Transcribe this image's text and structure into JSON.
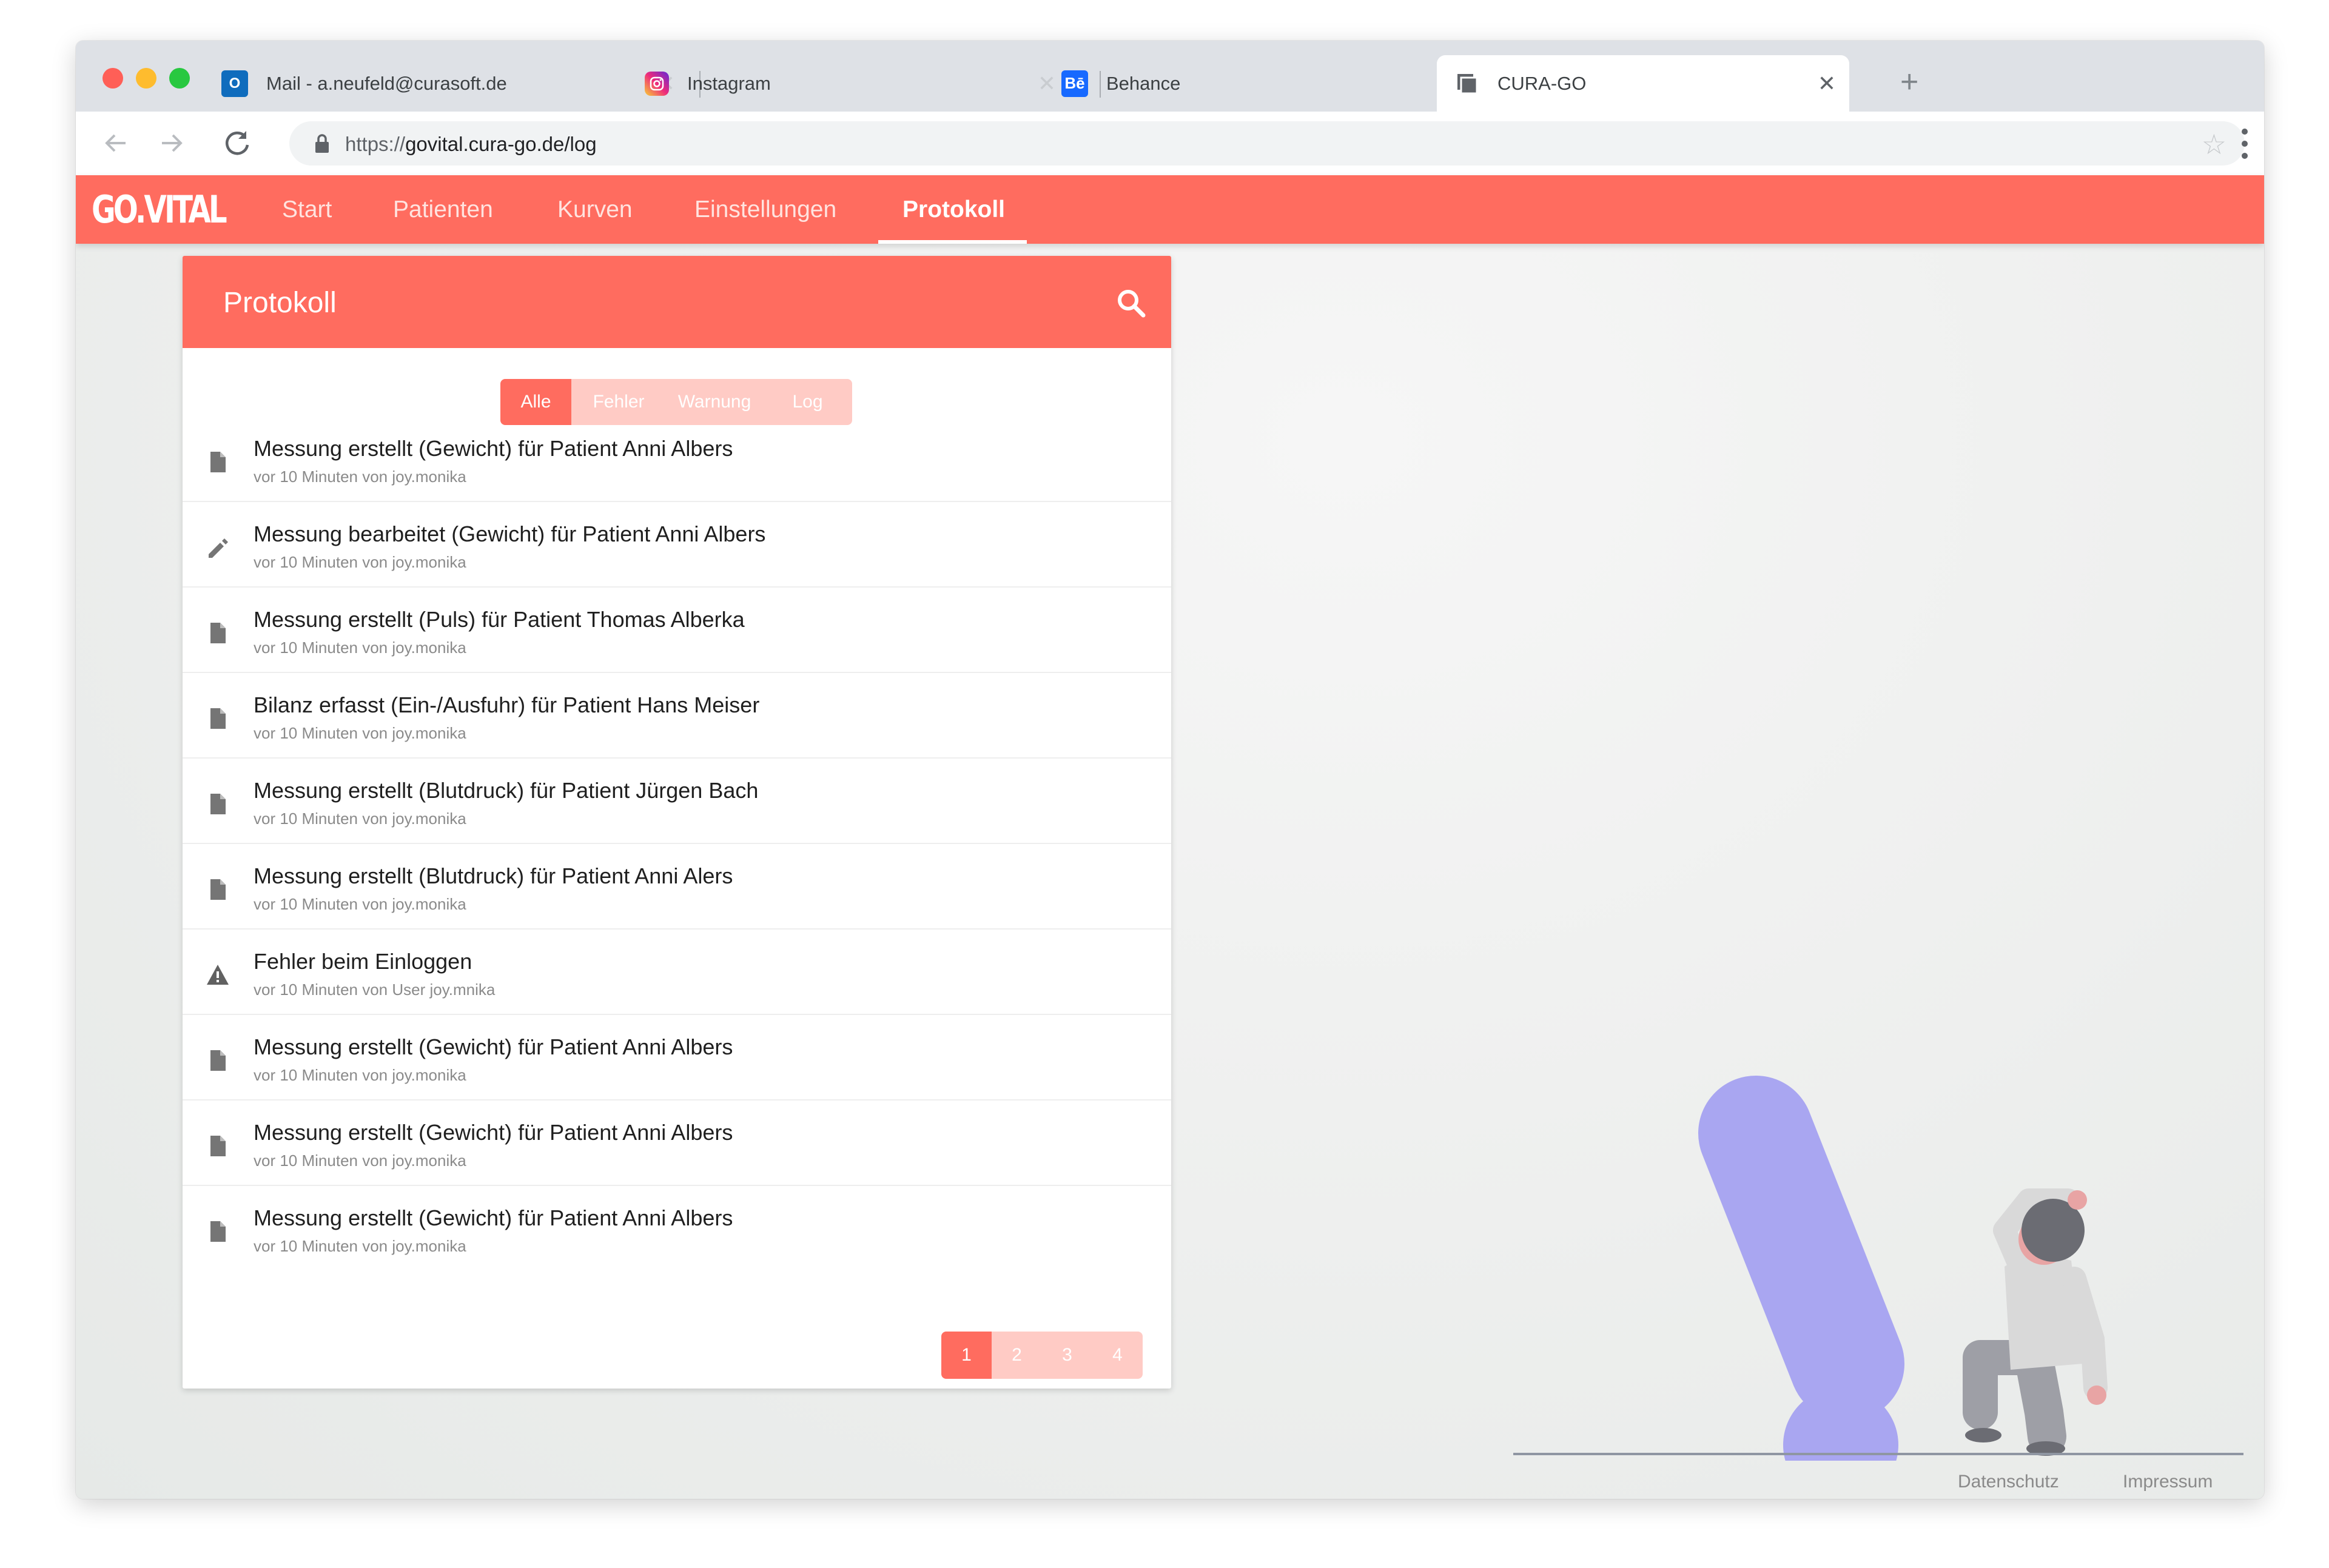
{
  "browser": {
    "tabs": [
      {
        "title": "Mail - a.neufeld@curasoft.de",
        "icon": "outlook-icon",
        "active": false
      },
      {
        "title": "Instagram",
        "icon": "instagram-icon",
        "active": false
      },
      {
        "title": "Behance",
        "icon": "behance-icon",
        "active": false
      },
      {
        "title": "CURA-GO",
        "icon": "window-icon",
        "active": true
      }
    ],
    "url": {
      "scheme": "https://",
      "host": "govital.cura-go.de/log"
    }
  },
  "app": {
    "logo": "GO.VITAL",
    "nav": [
      "Start",
      "Patienten",
      "Kurven",
      "Einstellungen",
      "Protokoll"
    ],
    "active_nav": "Protokoll",
    "accent_color": "#ff6c5f"
  },
  "card": {
    "title": "Protokoll",
    "filters": [
      "Alle",
      "Fehler",
      "Warnung",
      "Log"
    ],
    "active_filter": "Alle",
    "entries": [
      {
        "icon": "document-icon",
        "title": "Messung erstellt (Gewicht) für Patient Anni Albers",
        "sub": "vor 10 Minuten von joy.monika"
      },
      {
        "icon": "pencil-icon",
        "title": "Messung bearbeitet (Gewicht) für Patient Anni Albers",
        "sub": "vor 10 Minuten von joy.monika"
      },
      {
        "icon": "document-icon",
        "title": "Messung erstellt (Puls) für Patient Thomas Alberka",
        "sub": "vor 10 Minuten von joy.monika"
      },
      {
        "icon": "document-icon",
        "title": "Bilanz erfasst (Ein-/Ausfuhr) für Patient Hans Meiser",
        "sub": "vor 10 Minuten von joy.monika"
      },
      {
        "icon": "document-icon",
        "title": "Messung erstellt (Blutdruck) für Patient Jürgen Bach",
        "sub": "vor 10 Minuten von joy.monika"
      },
      {
        "icon": "document-icon",
        "title": "Messung erstellt (Blutdruck) für Patient Anni Alers",
        "sub": "vor 10 Minuten von joy.monika"
      },
      {
        "icon": "warning-icon",
        "title": "Fehler beim Einloggen",
        "sub": "vor 10 Minuten von User joy.mnika"
      },
      {
        "icon": "document-icon",
        "title": "Messung erstellt (Gewicht) für Patient Anni Albers",
        "sub": "vor 10 Minuten von joy.monika"
      },
      {
        "icon": "document-icon",
        "title": "Messung erstellt (Gewicht) für Patient Anni Albers",
        "sub": "vor 10 Minuten von joy.monika"
      },
      {
        "icon": "document-icon",
        "title": "Messung erstellt (Gewicht) für Patient Anni Albers",
        "sub": "vor 10 Minuten von joy.monika"
      }
    ],
    "pages": [
      "1",
      "2",
      "3",
      "4"
    ],
    "active_page": "1"
  },
  "footer": {
    "privacy": "Datenschutz",
    "imprint": "Impressum"
  }
}
